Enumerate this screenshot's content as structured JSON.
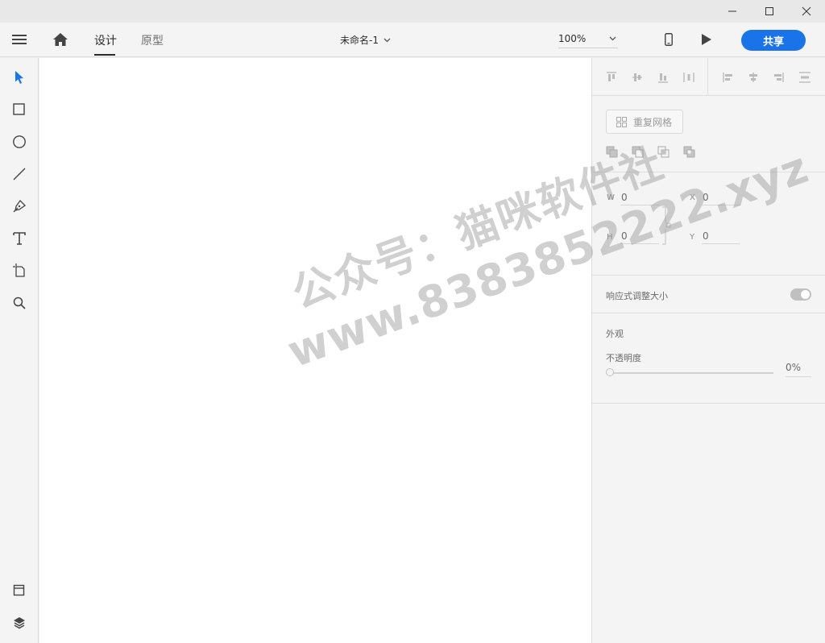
{
  "window": {
    "minimize_icon": "minimize-icon",
    "maximize_icon": "maximize-icon",
    "close_icon": "close-icon"
  },
  "toolbar": {
    "tabs": [
      {
        "label": "设计",
        "active": true
      },
      {
        "label": "原型",
        "active": false
      }
    ],
    "document_title": "未命名-1",
    "zoom": "100%",
    "share_label": "共享",
    "accent_color": "#1a73e8"
  },
  "left_tools": [
    {
      "name": "select-tool",
      "icon": "arrow-icon",
      "active": true
    },
    {
      "name": "rectangle-tool",
      "icon": "rectangle-icon"
    },
    {
      "name": "ellipse-tool",
      "icon": "ellipse-icon"
    },
    {
      "name": "line-tool",
      "icon": "line-icon"
    },
    {
      "name": "pen-tool",
      "icon": "pen-icon"
    },
    {
      "name": "text-tool",
      "icon": "text-icon"
    },
    {
      "name": "artboard-tool",
      "icon": "artboard-icon"
    },
    {
      "name": "zoom-tool",
      "icon": "magnifier-icon"
    },
    {
      "name": "assets-panel",
      "icon": "assets-icon"
    },
    {
      "name": "layers-panel",
      "icon": "layers-icon"
    }
  ],
  "properties": {
    "repeat_grid_label": "重复网格",
    "w_label": "W",
    "w_value": "0",
    "h_label": "H",
    "h_value": "0",
    "x_label": "X",
    "x_value": "0",
    "y_label": "Y",
    "y_value": "0",
    "responsive_resize_label": "响应式调整大小",
    "appearance_title": "外观",
    "opacity_label": "不透明度",
    "opacity_value": "0%"
  },
  "watermark": {
    "line1": "公众号：猫咪软件社",
    "line2": "www.8383852222.xyz"
  }
}
